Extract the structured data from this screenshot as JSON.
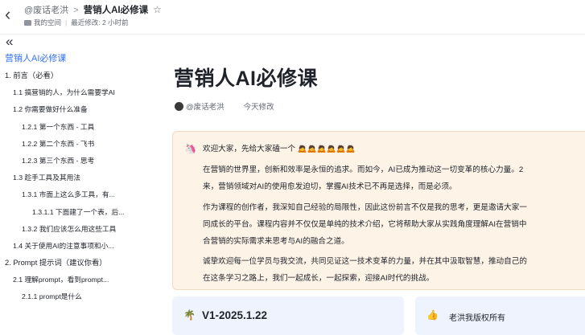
{
  "header": {
    "back_glyph": "‹",
    "author": "@废话老洪",
    "separator": ">",
    "doc_title": "营销人AI必修课",
    "space_label": "我的空间",
    "last_modified": "最近修改: 2 小时前"
  },
  "sidebar": {
    "collapse_glyph": "«",
    "title": "营销人AI必修课",
    "items": [
      {
        "label": "1. 前言（必看）",
        "level": 1
      },
      {
        "label": "1.1 搞营销的人，为什么需要学AI",
        "level": 2
      },
      {
        "label": "1.2 你需要做好什么准备",
        "level": 2
      },
      {
        "label": "1.2.1 第一个东西 - 工具",
        "level": 3
      },
      {
        "label": "1.2.2 第二个东西 - 飞书",
        "level": 3
      },
      {
        "label": "1.2.3 第三个东西 - 思考",
        "level": 3
      },
      {
        "label": "1.3 趁手工具及其用法",
        "level": 2
      },
      {
        "label": "1.3.1 市面上这么多工具，有...",
        "level": 3
      },
      {
        "label": "1.3.1.1 下面建了一个表，后...",
        "level": 4
      },
      {
        "label": "1.3.2 我们应该怎么用这些工具",
        "level": 3
      },
      {
        "label": "1.4 关于使用AI的注意事项和小...",
        "level": 2
      },
      {
        "label": "2. Prompt 提示词（建议你看）",
        "level": 1
      },
      {
        "label": "2.1 理解prompt，看到prompt...",
        "level": 2
      },
      {
        "label": "2.1.1 prompt是什么",
        "level": 3
      }
    ]
  },
  "main": {
    "title": "营销人AI必修课",
    "author": "@废话老洪",
    "modified": "今天修改",
    "callout": {
      "lines": [
        "欢迎大家，先给大家磕一个 🙇🙇🙇🙇🙇🙇",
        "在营销的世界里，创新和效率是永恒的追求。而如今，AI已成为推动这一切变革的核心力量。2",
        "来，营销领域对AI的使用愈发迫切，掌握AI技术已不再是选择，而是必须。",
        "作为课程的创作者，我深知自己经验的局限性，因此这份前言不仅是我的思考，更是邀请大家一",
        "同成长的平台。课程内容并不仅仅是单纯的技术介绍，它将帮助大家从实践角度理解AI在营销中",
        "合营销的实际需求来思考与AI的融合之道。",
        "诚挚欢迎每一位学员与我交流，共同见证这一技术变革的力量，并在其中汲取智慧，推动自己的",
        "在这条学习之路上，我们一起成长，一起探索，迎接AI时代的挑战。"
      ]
    },
    "card_version": "V1-2025.1.22",
    "card_copyright": "老洪我版权所有"
  }
}
